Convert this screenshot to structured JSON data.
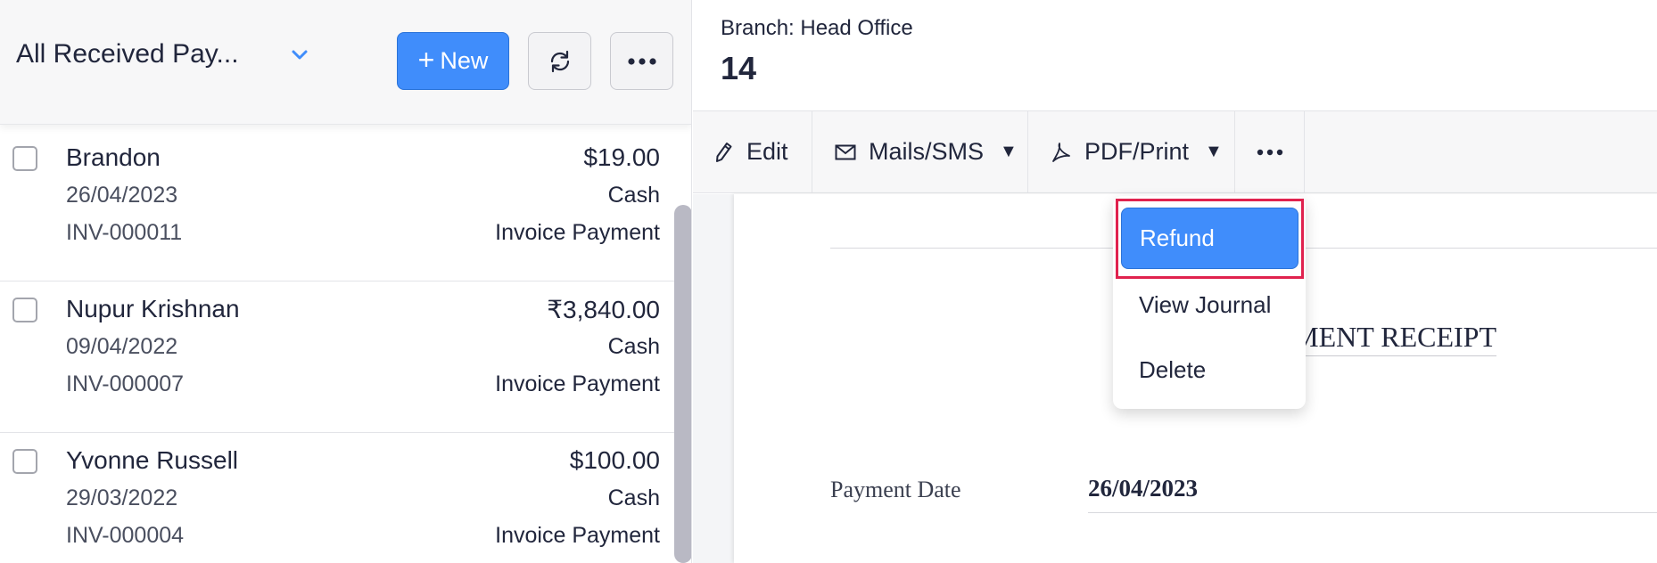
{
  "list_header": {
    "view_title": "All Received Pay...",
    "new_label": "New"
  },
  "payments": [
    {
      "name": "Brandon",
      "date": "26/04/2023",
      "invoice": "INV-000011",
      "amount": "$19.00",
      "mode": "Cash",
      "type": "Invoice Payment"
    },
    {
      "name": "Nupur Krishnan",
      "date": "09/04/2022",
      "invoice": "INV-000007",
      "amount": "₹3,840.00",
      "mode": "Cash",
      "type": "Invoice Payment"
    },
    {
      "name": "Yvonne Russell",
      "date": "29/03/2022",
      "invoice": "INV-000004",
      "amount": "$100.00",
      "mode": "Cash",
      "type": "Invoice Payment"
    }
  ],
  "detail": {
    "branch": "Branch: Head Office",
    "number": "14"
  },
  "toolbar": {
    "edit_label": "Edit",
    "mails_label": "Mails/SMS",
    "pdf_label": "PDF/Print"
  },
  "more_menu": {
    "refund": "Refund",
    "view_journal": "View Journal",
    "delete": "Delete"
  },
  "document": {
    "title": "PAYMENT RECEIPT",
    "payment_date_label": "Payment Date",
    "payment_date_value": "26/04/2023"
  },
  "colors": {
    "accent": "#408dfb",
    "highlight": "#e0224e"
  }
}
